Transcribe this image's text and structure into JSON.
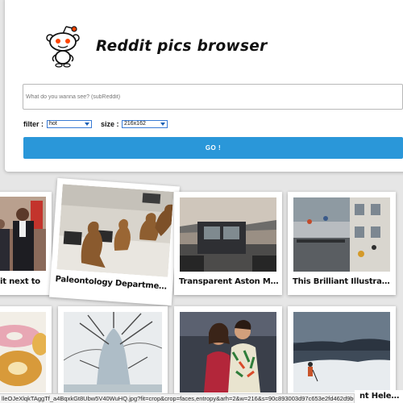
{
  "app": {
    "title": "Reddit pics browser",
    "logo_icon": "reddit-alien-icon"
  },
  "search": {
    "placeholder": "What do you wanna see? (subReddit)",
    "value": ""
  },
  "filter": {
    "label": "filter :",
    "selected": "hot"
  },
  "size": {
    "label": "size :",
    "selected": "216x162"
  },
  "go_button": {
    "label": "GO !"
  },
  "cards": [
    {
      "caption": "it next to"
    },
    {
      "caption": "Paleontology Department o..."
    },
    {
      "caption": "Transparent Aston Martin..."
    },
    {
      "caption": "This Brilliant Illustration S..."
    },
    {
      "caption": ""
    },
    {
      "caption": ""
    },
    {
      "caption": ""
    },
    {
      "caption": ""
    }
  ],
  "partial_caption": "nt Hele...",
  "status_bar": {
    "url": "lleOJeXlqkTAggTf_a4BqxkGt8Ubw5V40WuHQ.jpg?fit=crop&crop=faces,entropy&arh=2&w=216&s=90c893003d97c653e2fd462d9b0c076d"
  },
  "colors": {
    "accent": "#2a97d9",
    "page_bg": "#e6e6e6",
    "select_border": "#3a7bd5"
  }
}
